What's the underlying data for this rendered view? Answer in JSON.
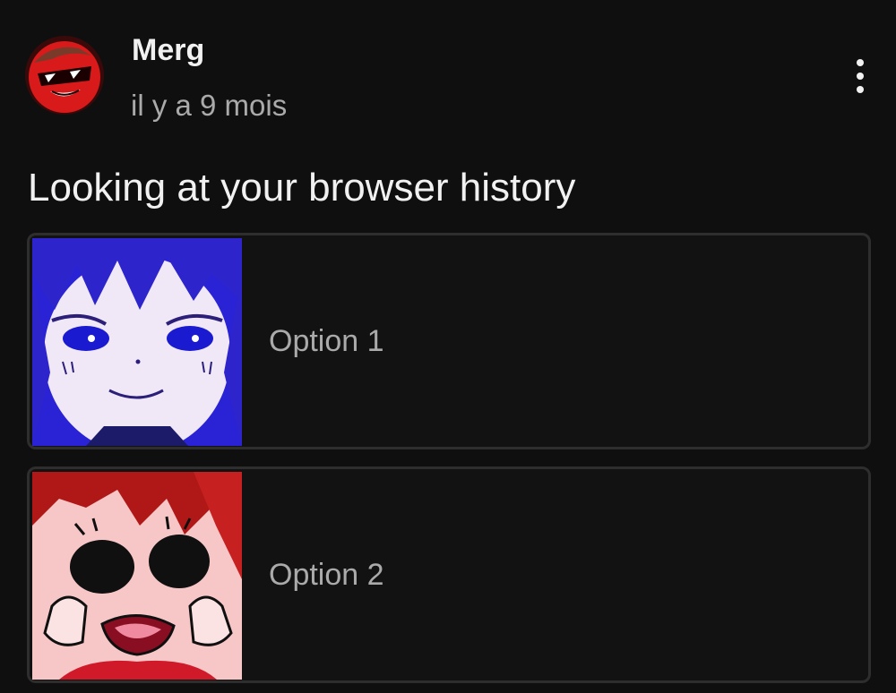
{
  "post": {
    "author": "Merg",
    "timestamp": "il y a 9 mois",
    "text": "Looking at your browser history",
    "more_icon": "more-vertical-icon"
  },
  "poll": {
    "options": [
      {
        "label": "Option 1",
        "image": "blue-anime-face-thumbnail"
      },
      {
        "label": "Option 2",
        "image": "pink-cartoon-face-thumbnail"
      }
    ]
  },
  "colors": {
    "background": "#0f0f0f",
    "author_text": "#f1f1f1",
    "secondary_text": "#aaaaaa",
    "option_border": "#2e2e2e"
  }
}
